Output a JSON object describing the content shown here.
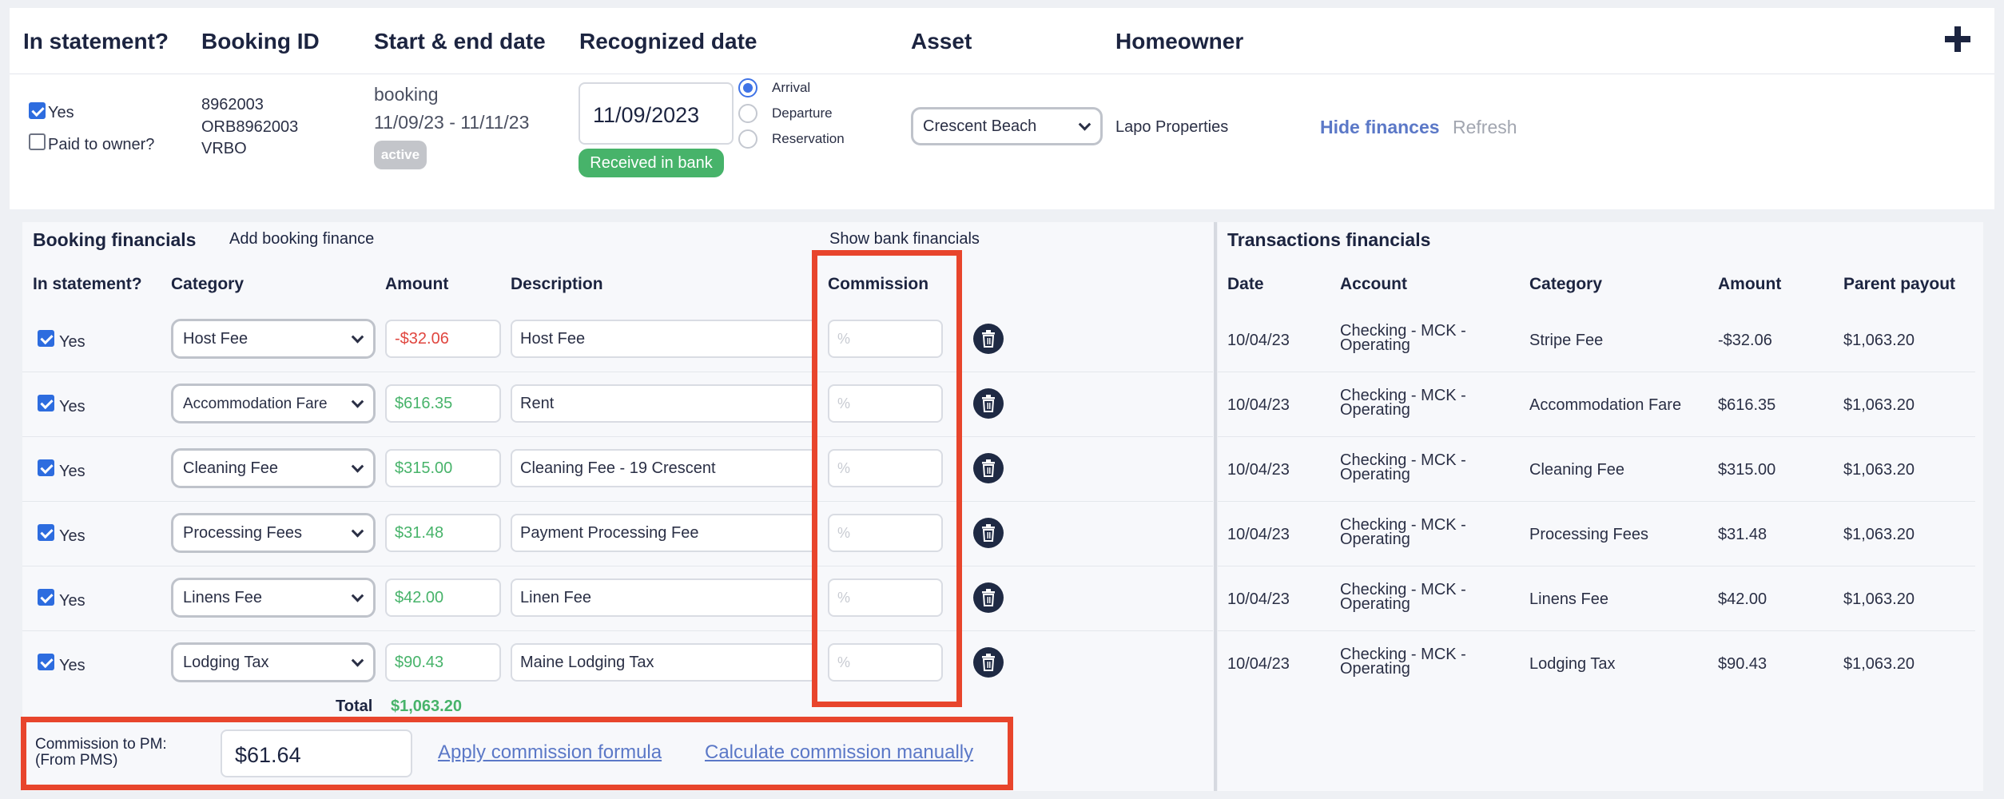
{
  "top": {
    "headers": [
      "In statement?",
      "Booking ID",
      "Start & end date",
      "Recognized date",
      "Asset",
      "Homeowner"
    ],
    "in_statement_label": "Yes",
    "paid_to_owner_label": "Paid to owner?",
    "booking_ids": [
      "8962003",
      "ORB8962003",
      "VRBO"
    ],
    "booking_type": "booking",
    "date_range": "11/09/23 - 11/11/23",
    "status_badge": "active",
    "recognized_date": "11/09/2023",
    "received_badge": "Received in bank",
    "radio_options": [
      "Arrival",
      "Departure",
      "Reservation"
    ],
    "asset": "Crescent Beach",
    "homeowner": "Lapo Properties",
    "hide_finances": "Hide finances",
    "refresh": "Refresh"
  },
  "booking_financials": {
    "title": "Booking financials",
    "add_label": "Add booking finance",
    "show_bank": "Show bank financials",
    "columns": [
      "In statement?",
      "Category",
      "Amount",
      "Description",
      "Commission"
    ],
    "commission_placeholder": "%",
    "rows": [
      {
        "in_statement": "Yes",
        "category": "Host Fee",
        "amount": "-$32.06",
        "description": "Host Fee"
      },
      {
        "in_statement": "Yes",
        "category": "Accommodation Fare",
        "amount": "$616.35",
        "description": "Rent"
      },
      {
        "in_statement": "Yes",
        "category": "Cleaning Fee",
        "amount": "$315.00",
        "description": "Cleaning Fee - 19 Crescent"
      },
      {
        "in_statement": "Yes",
        "category": "Processing Fees",
        "amount": "$31.48",
        "description": "Payment Processing Fee"
      },
      {
        "in_statement": "Yes",
        "category": "Linens Fee",
        "amount": "$42.00",
        "description": "Linen Fee"
      },
      {
        "in_statement": "Yes",
        "category": "Lodging Tax",
        "amount": "$90.43",
        "description": "Maine Lodging Tax"
      }
    ],
    "total_label": "Total",
    "total_value": "$1,063.20",
    "commission_label_1": "Commission to PM:",
    "commission_label_2": "(From PMS)",
    "commission_value": "$61.64",
    "apply_formula": "Apply commission formula",
    "calc_manual": "Calculate commission manually"
  },
  "transactions": {
    "title": "Transactions financials",
    "columns": [
      "Date",
      "Account",
      "Category",
      "Amount",
      "Parent payout"
    ],
    "rows": [
      {
        "date": "10/04/23",
        "account_1": "Checking - MCK -",
        "account_2": "Operating",
        "category": "Stripe Fee",
        "amount": "-$32.06",
        "payout": "$1,063.20"
      },
      {
        "date": "10/04/23",
        "account_1": "Checking - MCK -",
        "account_2": "Operating",
        "category": "Accommodation Fare",
        "amount": "$616.35",
        "payout": "$1,063.20"
      },
      {
        "date": "10/04/23",
        "account_1": "Checking - MCK -",
        "account_2": "Operating",
        "category": "Cleaning Fee",
        "amount": "$315.00",
        "payout": "$1,063.20"
      },
      {
        "date": "10/04/23",
        "account_1": "Checking - MCK -",
        "account_2": "Operating",
        "category": "Processing Fees",
        "amount": "$31.48",
        "payout": "$1,063.20"
      },
      {
        "date": "10/04/23",
        "account_1": "Checking - MCK -",
        "account_2": "Operating",
        "category": "Linens Fee",
        "amount": "$42.00",
        "payout": "$1,063.20"
      },
      {
        "date": "10/04/23",
        "account_1": "Checking - MCK -",
        "account_2": "Operating",
        "category": "Lodging Tax",
        "amount": "$90.43",
        "payout": "$1,063.20"
      }
    ]
  },
  "colors": {
    "negative": "#e0463f",
    "positive": "#47b36a",
    "badge_green": "#47b36a",
    "badge_gray": "#c3c5ca",
    "link": "#5b78c7",
    "annotation": "#e8452c"
  },
  "icons": [
    "plus-icon",
    "chevron-down-icon",
    "trash-icon"
  ]
}
